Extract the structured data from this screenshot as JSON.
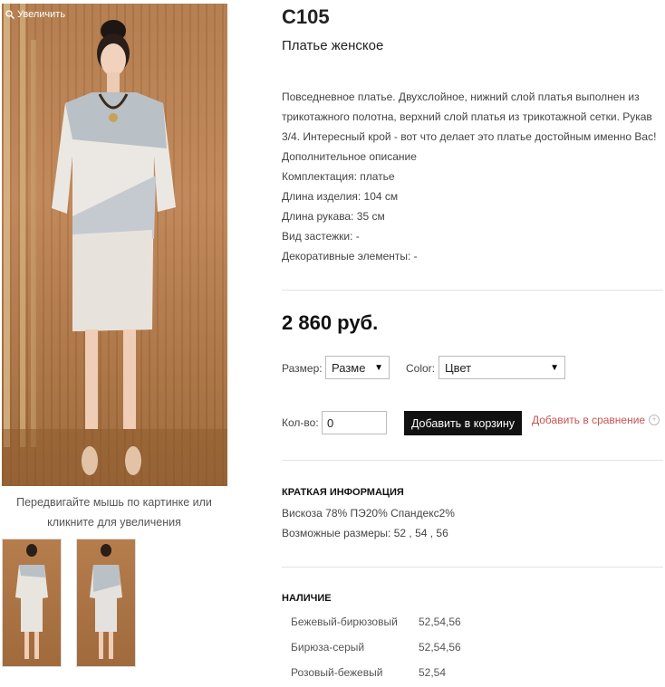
{
  "product": {
    "zoom_label": "Увеличить",
    "hint_line1": "Передвигайте мышь по картинке или",
    "hint_line2": "кликните для увеличения",
    "sku": "С105",
    "name": "Платье женское",
    "description_lines": [
      "Повседневное платье. Двухслойное, нижний слой платья выполнен из",
      "трикотажного полотна, верхний слой платья из трикотажной сетки. Рукав",
      "3/4. Интересный крой - вот что делает это платье достойным именно Вас!",
      "Дополнительное описание",
      "Комплектация: платье",
      "Длина изделия: 104 см",
      "Длина рукава: 35 см",
      "Вид застежки: -",
      "Декоративные элементы: -"
    ],
    "price": "2 860 руб."
  },
  "options": {
    "size_label": "Размер:",
    "size_value": "Разме",
    "color_label": "Color:",
    "color_value": "Цвет",
    "qty_label": "Кол-во:",
    "qty_value": "0",
    "add_to_cart": "Добавить в корзину",
    "add_to_compare": "Добавить в сравнение"
  },
  "short_info": {
    "title": "КРАТКАЯ ИНФОРМАЦИЯ",
    "composition": "Вискоза 78% ПЭ20% Спандекс2%",
    "sizes": "Возможные размеры: 52 , 54 , 56"
  },
  "availability": {
    "title": "НАЛИЧИЕ",
    "rows": [
      {
        "color": "Бежевый-бирюзовый",
        "sizes": "52,54,56"
      },
      {
        "color": "Бирюза-серый",
        "sizes": "52,54,56"
      },
      {
        "color": "Розовый-бежевый",
        "sizes": "52,54"
      }
    ]
  },
  "icons": {
    "zoom": "magnifier-icon",
    "select_arrow": "dropdown-arrow-icon",
    "compare": "plus-circle-icon"
  },
  "colors": {
    "compare_link": "#c9524f",
    "cart_button": "#111111"
  }
}
